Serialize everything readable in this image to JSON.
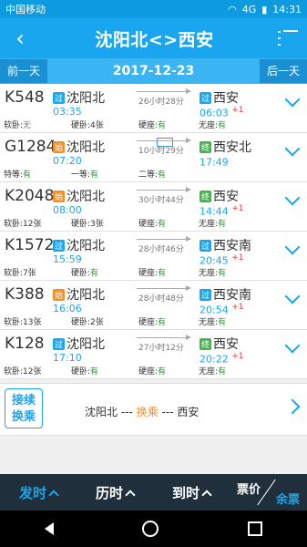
{
  "statusbar": {
    "carrier": "中国移动",
    "time": "14:31",
    "signal": "4G",
    "wifi": "wifi",
    "battery": "battery"
  },
  "header": {
    "title": "沈阳北<>西安",
    "back_icon": "back-icon",
    "menu_icon": "menu-icon"
  },
  "datebar": {
    "prev": "前一天",
    "date": "2017-12-23",
    "next": "后一天"
  },
  "trains": [
    {
      "code": "K548",
      "from_badge": "过",
      "from_type": "pass",
      "from": "沈阳北",
      "dep": "03:35",
      "duration": "26小时28分",
      "to_badge": "过",
      "to_type": "pass",
      "to": "西安",
      "arr": "06:03",
      "plus": "+1",
      "seat1_label": "软卧:",
      "seat1_value": "无",
      "seat2_label": "硬卧:",
      "seat2_value": "4张",
      "seat3_label": "硬座:",
      "seat3_value": "有",
      "seat4_label": "无座:",
      "seat4_value": "有"
    },
    {
      "code": "G1284",
      "from_badge": "始",
      "from_type": "start",
      "from": "沈阳北",
      "dep": "07:20",
      "duration": "10小时29分",
      "to_badge": "终",
      "to_type": "end",
      "to": "西安北",
      "arr": "17:49",
      "plus": "",
      "seat1_label": "特等:",
      "seat1_value": "有",
      "seat2_label": "一等:",
      "seat2_value": "有",
      "seat3_label": "二等:",
      "seat3_value": "有",
      "seat4_label": "",
      "seat4_value": ""
    },
    {
      "code": "K2048",
      "from_badge": "始",
      "from_type": "start",
      "from": "沈阳北",
      "dep": "08:00",
      "duration": "30小时44分",
      "to_badge": "终",
      "to_type": "end",
      "to": "西安",
      "arr": "14:44",
      "plus": "+1",
      "seat1_label": "软卧:",
      "seat1_value": "12张",
      "seat2_label": "硬卧:",
      "seat2_value": "3张",
      "seat3_label": "硬座:",
      "seat3_value": "有",
      "seat4_label": "无座:",
      "seat4_value": "有"
    },
    {
      "code": "K1572",
      "from_badge": "过",
      "from_type": "pass",
      "from": "沈阳北",
      "dep": "15:59",
      "duration": "28小时46分",
      "to_badge": "过",
      "to_type": "pass",
      "to": "西安南",
      "arr": "20:45",
      "plus": "+1",
      "seat1_label": "软卧:",
      "seat1_value": "7张",
      "seat2_label": "硬卧:",
      "seat2_value": "有",
      "seat3_label": "硬座:",
      "seat3_value": "有",
      "seat4_label": "无座:",
      "seat4_value": "有"
    },
    {
      "code": "K388",
      "from_badge": "始",
      "from_type": "start",
      "from": "沈阳北",
      "dep": "16:06",
      "duration": "28小时48分",
      "to_badge": "过",
      "to_type": "pass",
      "to": "西安南",
      "arr": "20:54",
      "plus": "+1",
      "seat1_label": "软卧:",
      "seat1_value": "13张",
      "seat2_label": "硬卧:",
      "seat2_value": "2张",
      "seat3_label": "硬座:",
      "seat3_value": "有",
      "seat4_label": "无座:",
      "seat4_value": "有"
    },
    {
      "code": "K128",
      "from_badge": "过",
      "from_type": "pass",
      "from": "沈阳北",
      "dep": "17:10",
      "duration": "27小时12分",
      "to_badge": "终",
      "to_type": "end",
      "to": "西安",
      "arr": "20:22",
      "plus": "+1",
      "seat1_label": "软卧:",
      "seat1_value": "12张",
      "seat2_label": "硬卧:",
      "seat2_value": "有",
      "seat3_label": "硬座:",
      "seat3_value": "有",
      "seat4_label": "无座:",
      "seat4_value": "有"
    }
  ],
  "transfer": {
    "button_line1": "接续",
    "button_line2": "换乘",
    "route_start": "沈阳北",
    "route_mid": "换乘",
    "route_end": "西安",
    "sep": "---"
  },
  "bottom": {
    "tab1": "发时",
    "tab2": "历时",
    "tab3": "到时",
    "split_top": "票价",
    "split_bottom": "余票"
  }
}
